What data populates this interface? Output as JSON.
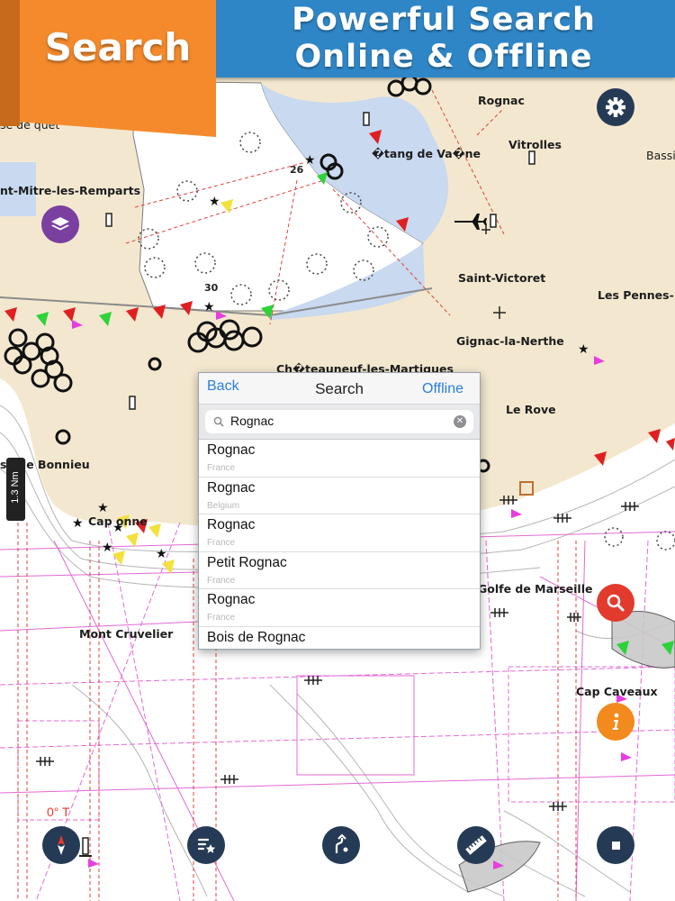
{
  "banner": {
    "ribbon_label": "Search",
    "title_line1": "Powerful Search",
    "title_line2": "Online & Offline",
    "ribbon_color": "#f48a2c",
    "banner_color": "#2f86c6"
  },
  "map": {
    "places": [
      "Rognac",
      "Vitrolles",
      "Bassi",
      "se de   quet",
      "nt-Mitre-les-Remparts",
      "�tang de Va�ne",
      "Saint-Victoret",
      "Les Pennes-",
      "Gignac-la-Nerthe",
      "Ch�teauneuf-les-Martiques",
      "Le Rove",
      "se de Bonnieu",
      "Cap   onne",
      "Mont Cruvelier",
      "Golfe de Marseille",
      "Cap Caveaux"
    ],
    "depth_labels": [
      "26",
      "30"
    ],
    "scale_label": "1.3 Nm",
    "heading_label": "0° T"
  },
  "search_panel": {
    "back_label": "Back",
    "title": "Search",
    "offline_label": "Offline",
    "query": "Rognac",
    "results": [
      {
        "name": "Rognac",
        "country": "France"
      },
      {
        "name": "Rognac",
        "country": "Belgium"
      },
      {
        "name": "Rognac",
        "country": "France"
      },
      {
        "name": "Petit Rognac",
        "country": "France"
      },
      {
        "name": "Rognac",
        "country": "France"
      },
      {
        "name": "Bois de Rognac",
        "country": ""
      }
    ]
  },
  "controls": {
    "settings_icon": "gear-icon",
    "layers_icon": "layers-icon",
    "search_icon": "magnifier-icon",
    "info_icon": "info-icon",
    "compass_icon": "compass-icon",
    "favorites_icon": "favorites-list-icon",
    "route_icon": "route-icon",
    "measure_icon": "ruler-icon",
    "stop_icon": "stop-icon",
    "accent_red": "#e23a2c",
    "accent_orange": "#f28a1e",
    "accent_purple": "#7b3fa0"
  }
}
